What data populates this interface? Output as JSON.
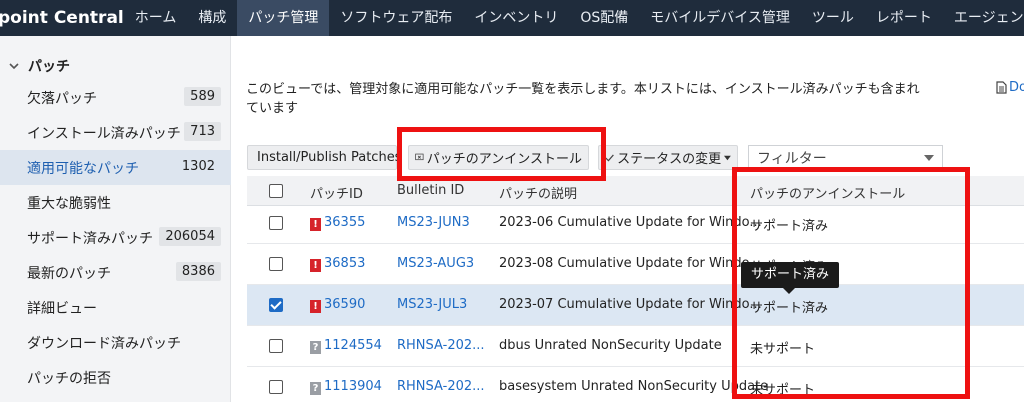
{
  "nav": {
    "brand": "point Central",
    "items": [
      "ホーム",
      "構成",
      "パッチ管理",
      "ソフトウェア配布",
      "インベントリ",
      "OS配備",
      "モバイルデバイス管理",
      "ツール",
      "レポート",
      "エージェン"
    ],
    "active_index": 2
  },
  "sidebar": {
    "section_title": "パッチ",
    "items": [
      {
        "label": "欠落パッチ",
        "count": "589"
      },
      {
        "label": "インストール済みパッチ",
        "count": "713"
      },
      {
        "label": "適用可能なパッチ",
        "count": "1302"
      },
      {
        "label": "重大な脆弱性",
        "count": ""
      },
      {
        "label": "サポート済みパッチ",
        "count": "206054"
      },
      {
        "label": "最新のパッチ",
        "count": "8386"
      },
      {
        "label": "詳細ビュー",
        "count": ""
      },
      {
        "label": "ダウンロード済みパッチ",
        "count": ""
      },
      {
        "label": "パッチの拒否",
        "count": ""
      }
    ],
    "active_index": 2
  },
  "main": {
    "description": "このビューでは、管理対象に適用可能なパッチ一覧を表示します。本リストには、インストール済みパッチも含まれています",
    "doc_link": "Do",
    "toolbar": {
      "install_publish": "Install/Publish Patches",
      "uninstall": "パッチのアンインストール",
      "change_status": "ステータスの変更",
      "filter_placeholder": "フィルター"
    },
    "table": {
      "headers": {
        "patch_id": "パッチID",
        "bulletin_id": "Bulletin ID",
        "description": "パッチの説明",
        "uninstall": "パッチのアンインストール"
      },
      "rows": [
        {
          "severity": "critical",
          "patch_id": "36355",
          "bulletin_id": "MS23-JUN3",
          "description": "2023-06 Cumulative Update for Windo...",
          "uninstall": "サポート済み",
          "checked": false
        },
        {
          "severity": "critical",
          "patch_id": "36853",
          "bulletin_id": "MS23-AUG3",
          "description": "2023-08 Cumulative Update for Windo...",
          "uninstall": "サポート済み",
          "checked": false
        },
        {
          "severity": "critical",
          "patch_id": "36590",
          "bulletin_id": "MS23-JUL3",
          "description": "2023-07 Cumulative Update for Windo...",
          "uninstall": "サポート済み",
          "checked": true
        },
        {
          "severity": "unknown",
          "patch_id": "1124554",
          "bulletin_id": "RHNSA-202...",
          "description": "dbus Unrated NonSecurity Update",
          "uninstall": "未サポート",
          "checked": false
        },
        {
          "severity": "unknown",
          "patch_id": "1113904",
          "bulletin_id": "RHNSA-202...",
          "description": "basesystem Unrated NonSecurity Update",
          "uninstall": "未サポート",
          "checked": false
        }
      ]
    },
    "tooltip": "サポート済み"
  },
  "colors": {
    "nav_bg": "#1f2c3c",
    "nav_active": "#3a4b63",
    "link": "#1e6bc5",
    "highlight": "#ee1111",
    "critical": "#d6232a"
  }
}
